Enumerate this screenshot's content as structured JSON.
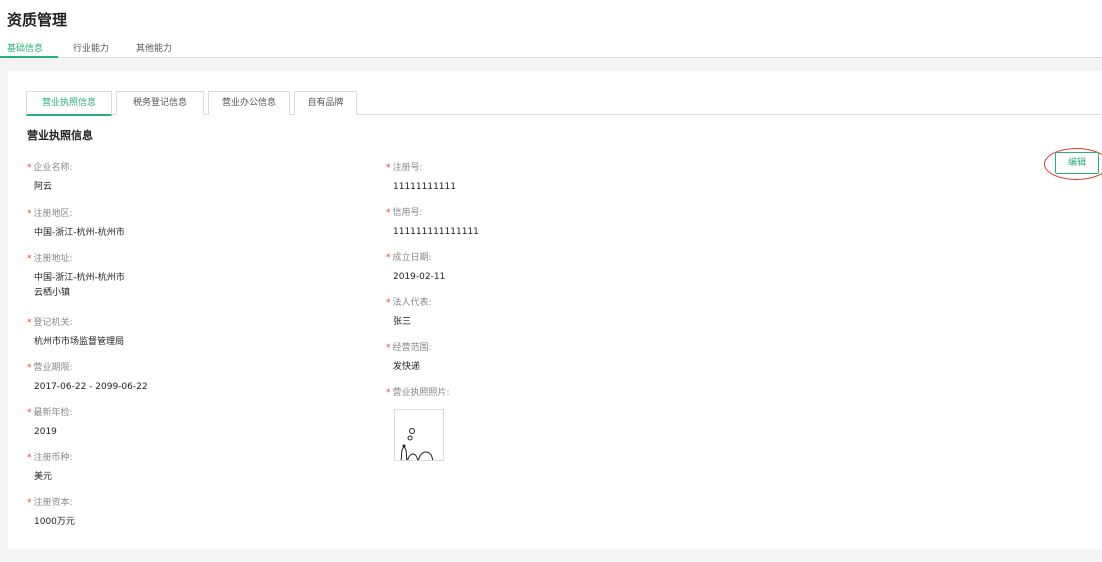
{
  "page": {
    "title": "资质管理"
  },
  "top_tabs": [
    {
      "label": "基础信息",
      "active": true
    },
    {
      "label": "行业能力",
      "active": false
    },
    {
      "label": "其他能力",
      "active": false
    }
  ],
  "sub_tabs": [
    {
      "label": "营业执照信息",
      "active": true
    },
    {
      "label": "税务登记信息",
      "active": false
    },
    {
      "label": "营业办公信息",
      "active": false
    },
    {
      "label": "自有品牌",
      "active": false
    }
  ],
  "section_title": "营业执照信息",
  "required_mark": "*",
  "edit_button": "编辑",
  "left_fields": [
    {
      "label": "企业名称:",
      "value": "阿云"
    },
    {
      "label": "注册地区:",
      "value": "中国-浙江-杭州-杭州市"
    },
    {
      "label": "注册地址:",
      "value": "中国-浙江-杭州-杭州市",
      "value2": "云栖小镇"
    },
    {
      "label": "登记机关:",
      "value": "杭州市市场监督管理局"
    },
    {
      "label": "营业期限:",
      "value": "2017-06-22 - 2099-06-22"
    },
    {
      "label": "最新年检:",
      "value": "2019"
    },
    {
      "label": "注册币种:",
      "value": "美元"
    },
    {
      "label": "注册资本:",
      "value": "1000万元"
    }
  ],
  "right_fields": [
    {
      "label": "注册号:",
      "value": "11111111111"
    },
    {
      "label": "信用号:",
      "value": "111111111111111"
    },
    {
      "label": "成立日期:",
      "value": "2019-02-11"
    },
    {
      "label": "法人代表:",
      "value": "张三"
    },
    {
      "label": "经营范围:",
      "value": "发快递"
    },
    {
      "label": "营业执照照片:"
    }
  ],
  "colors": {
    "accent": "#28b07a",
    "required": "#e8403a",
    "annotation": "#e0352b"
  }
}
